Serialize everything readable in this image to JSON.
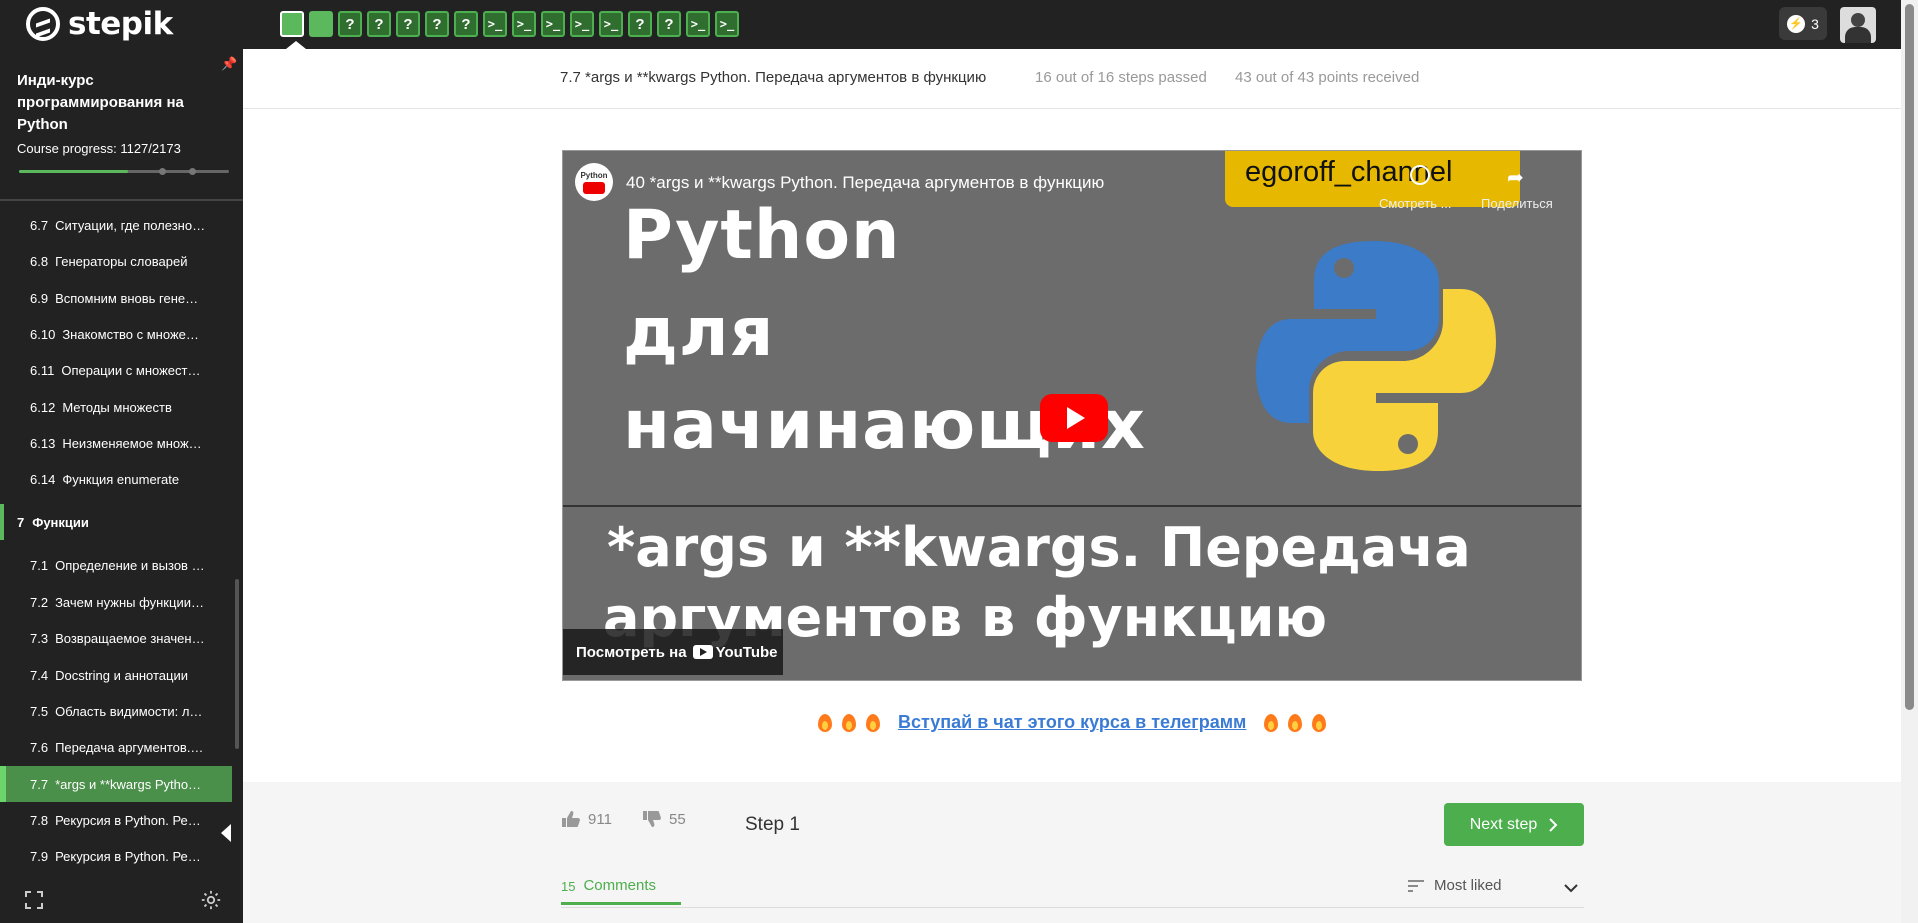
{
  "app": {
    "name": "stepik"
  },
  "topbar": {
    "step_icons": [
      "",
      "",
      "?",
      "?",
      "?",
      "?",
      "?",
      ">_",
      ">_",
      ">_",
      ">_",
      ">_",
      "?",
      "?",
      ">_",
      ">_"
    ],
    "energy_count": "3"
  },
  "sidebar": {
    "course_title": "Инди-курс программирования на Python",
    "progress_label": "Course progress:  1127/2173",
    "progress": {
      "passed": 1127,
      "total": 2173
    },
    "lessons": [
      {
        "num": "6.7",
        "label": "Ситуации, где полезно…"
      },
      {
        "num": "6.8",
        "label": "Генераторы словарей"
      },
      {
        "num": "6.9",
        "label": "Вспомним вновь гене…"
      },
      {
        "num": "6.10",
        "label": "Знакомство с множе…"
      },
      {
        "num": "6.11",
        "label": "Операции с множест…"
      },
      {
        "num": "6.12",
        "label": "Методы множеств"
      },
      {
        "num": "6.13",
        "label": "Неизменяемое множ…"
      },
      {
        "num": "6.14",
        "label": "Функция enumerate"
      }
    ],
    "section": {
      "num": "7",
      "label": "Функции"
    },
    "lessons7": [
      {
        "num": "7.1",
        "label": "Определение и вызов …"
      },
      {
        "num": "7.2",
        "label": "Зачем нужны функции…"
      },
      {
        "num": "7.3",
        "label": "Возвращаемое значен…"
      },
      {
        "num": "7.4",
        "label": "Docstring и аннотации"
      },
      {
        "num": "7.5",
        "label": "Область видимости: л…"
      },
      {
        "num": "7.6",
        "label": "Передача аргументов.…"
      },
      {
        "num": "7.7",
        "label": "*args и **kwargs Pytho…"
      },
      {
        "num": "7.8",
        "label": "Рекурсия в Python. Ре…"
      },
      {
        "num": "7.9",
        "label": "Рекурсия в Python. Ре…"
      }
    ]
  },
  "header": {
    "lesson_title": "7.7 *args и **kwargs Python. Передача аргументов в функцию",
    "steps_passed": "16 out of 16 steps passed",
    "points": "43 out of 43 points  received"
  },
  "video": {
    "title": "40 *args и **kwargs Python. Передача аргументов в функцию",
    "channel_icon_text": "Python",
    "channel_badge": "egoroff_channel",
    "watch_later": "Смотреть ...",
    "share": "Поделиться",
    "line1": "Python",
    "line2": "для",
    "line3": "начинающих",
    "sub1": "*args и **kwargs. Передача",
    "sub2": "аргументов в функцию",
    "watch_on": "Посмотреть на",
    "youtube": "YouTube"
  },
  "telegram": {
    "link": "Вступай в чат этого курса в телеграмм"
  },
  "footer": {
    "likes": "911",
    "dislikes": "55",
    "step_label": "Step 1",
    "next_step": "Next step",
    "comments_count": "15",
    "comments_label": "Comments",
    "sort_label": "Most liked"
  },
  "colors": {
    "accent": "#4cae4c",
    "topbar": "#222222",
    "link": "#3a7bd5"
  }
}
